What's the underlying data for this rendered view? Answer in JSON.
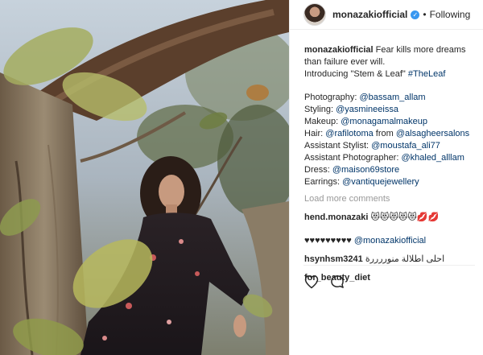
{
  "post": {
    "username": "monazakiofficial",
    "verified": true,
    "separator": "•",
    "follow_status": "Following"
  },
  "caption": {
    "author": "monazakiofficial",
    "text_line1": "Fear kills more dreams",
    "text_line2": "than failure ever will.",
    "text_line3_prefix": "Introducing \"Stem & Leaf\" ",
    "hashtag": "#TheLeaf",
    "credits": [
      {
        "label": "Photography: ",
        "mention": "@bassam_allam"
      },
      {
        "label": "Styling: ",
        "mention": "@yasmineeissa"
      },
      {
        "label": "Makeup: ",
        "mention": "@monagamalmakeup"
      },
      {
        "label": "Hair: ",
        "mention": "@rafilotoma",
        "middle": " from ",
        "mention2": "@alsagheersalons"
      },
      {
        "label": "Assistant Stylist: ",
        "mention": "@moustafa_ali77"
      },
      {
        "label": "Assistant Photographer: ",
        "mention": "@khaled_alllam"
      },
      {
        "label": "Dress: ",
        "mention": "@maison69store"
      },
      {
        "label": "Earrings: ",
        "mention": "@vantiquejewellery"
      }
    ]
  },
  "load_more": "Load more comments",
  "comments": [
    {
      "user": "hend.monazaki",
      "text": " 😻😻😻😻😻💋💋"
    },
    {
      "user": "",
      "text": "♥♥♥♥♥♥♥♥♥ ",
      "mention": "@monazakiofficial"
    },
    {
      "user": "hsynhsm3241",
      "text": " احلى اطلالة منوررررة"
    },
    {
      "user": "for_beauty_diet",
      "text": ""
    }
  ],
  "icons": {
    "like": "heart-outline-icon",
    "comment": "speech-bubble-icon"
  },
  "colors": {
    "link": "#003569",
    "verified": "#3897f0",
    "muted": "#999999"
  }
}
